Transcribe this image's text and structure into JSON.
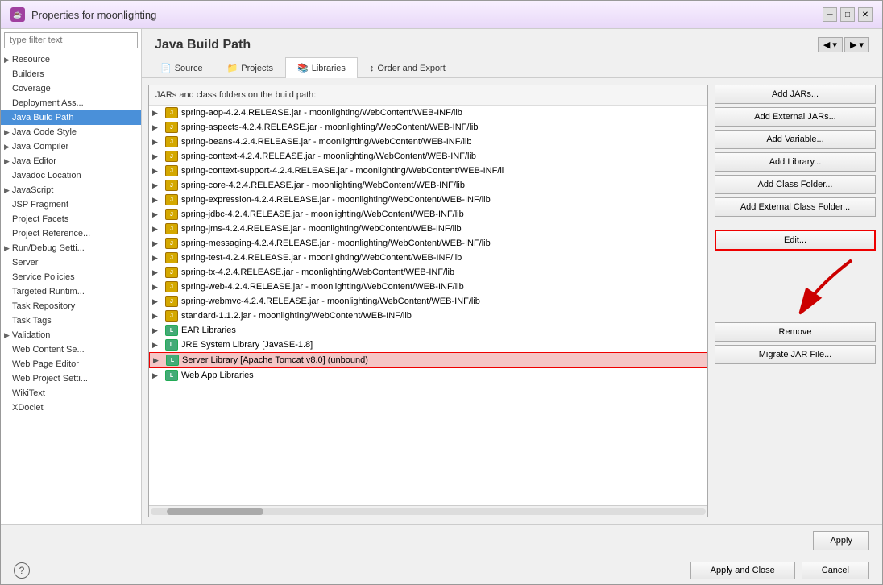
{
  "window": {
    "title": "Properties for moonlighting",
    "title_icon": "☕"
  },
  "sidebar": {
    "search_placeholder": "type filter text",
    "items": [
      {
        "label": "Resource",
        "arrow": true,
        "active": false
      },
      {
        "label": "Builders",
        "arrow": false,
        "active": false
      },
      {
        "label": "Coverage",
        "arrow": false,
        "active": false
      },
      {
        "label": "Deployment Ass...",
        "arrow": false,
        "active": false
      },
      {
        "label": "Java Build Path",
        "arrow": false,
        "active": true
      },
      {
        "label": "Java Code Style",
        "arrow": true,
        "active": false
      },
      {
        "label": "Java Compiler",
        "arrow": true,
        "active": false
      },
      {
        "label": "Java Editor",
        "arrow": true,
        "active": false
      },
      {
        "label": "Javadoc Location",
        "arrow": false,
        "active": false
      },
      {
        "label": "JavaScript",
        "arrow": true,
        "active": false
      },
      {
        "label": "JSP Fragment",
        "arrow": false,
        "active": false
      },
      {
        "label": "Project Facets",
        "arrow": false,
        "active": false
      },
      {
        "label": "Project Reference...",
        "arrow": false,
        "active": false
      },
      {
        "label": "Run/Debug Setti...",
        "arrow": true,
        "active": false
      },
      {
        "label": "Server",
        "arrow": false,
        "active": false
      },
      {
        "label": "Service Policies",
        "arrow": false,
        "active": false
      },
      {
        "label": "Targeted Runtim...",
        "arrow": false,
        "active": false
      },
      {
        "label": "Task Repository",
        "arrow": false,
        "active": false
      },
      {
        "label": "Task Tags",
        "arrow": false,
        "active": false
      },
      {
        "label": "Validation",
        "arrow": true,
        "active": false
      },
      {
        "label": "Web Content Se...",
        "arrow": false,
        "active": false
      },
      {
        "label": "Web Page Editor",
        "arrow": false,
        "active": false
      },
      {
        "label": "Web Project Setti...",
        "arrow": false,
        "active": false
      },
      {
        "label": "WikiText",
        "arrow": false,
        "active": false
      },
      {
        "label": "XDoclet",
        "arrow": false,
        "active": false
      }
    ]
  },
  "main": {
    "title": "Java Build Path",
    "tabs": [
      {
        "label": "Source",
        "icon": "📄"
      },
      {
        "label": "Projects",
        "icon": "📁"
      },
      {
        "label": "Libraries",
        "icon": "📚",
        "active": true
      },
      {
        "label": "Order and Export",
        "icon": "↕"
      }
    ],
    "tree_header": "JARs and class folders on the build path:",
    "tree_items": [
      {
        "type": "jar",
        "text": "spring-aop-4.2.4.RELEASE.jar - moonlighting/WebContent/WEB-INF/lib"
      },
      {
        "type": "jar",
        "text": "spring-aspects-4.2.4.RELEASE.jar - moonlighting/WebContent/WEB-INF/lib"
      },
      {
        "type": "jar",
        "text": "spring-beans-4.2.4.RELEASE.jar - moonlighting/WebContent/WEB-INF/lib"
      },
      {
        "type": "jar",
        "text": "spring-context-4.2.4.RELEASE.jar - moonlighting/WebContent/WEB-INF/lib"
      },
      {
        "type": "jar",
        "text": "spring-context-support-4.2.4.RELEASE.jar - moonlighting/WebContent/WEB-INF/li"
      },
      {
        "type": "jar",
        "text": "spring-core-4.2.4.RELEASE.jar - moonlighting/WebContent/WEB-INF/lib"
      },
      {
        "type": "jar",
        "text": "spring-expression-4.2.4.RELEASE.jar - moonlighting/WebContent/WEB-INF/lib"
      },
      {
        "type": "jar",
        "text": "spring-jdbc-4.2.4.RELEASE.jar - moonlighting/WebContent/WEB-INF/lib"
      },
      {
        "type": "jar",
        "text": "spring-jms-4.2.4.RELEASE.jar - moonlighting/WebContent/WEB-INF/lib"
      },
      {
        "type": "jar",
        "text": "spring-messaging-4.2.4.RELEASE.jar - moonlighting/WebContent/WEB-INF/lib"
      },
      {
        "type": "jar",
        "text": "spring-test-4.2.4.RELEASE.jar - moonlighting/WebContent/WEB-INF/lib"
      },
      {
        "type": "jar",
        "text": "spring-tx-4.2.4.RELEASE.jar - moonlighting/WebContent/WEB-INF/lib"
      },
      {
        "type": "jar",
        "text": "spring-web-4.2.4.RELEASE.jar - moonlighting/WebContent/WEB-INF/lib"
      },
      {
        "type": "jar",
        "text": "spring-webmvc-4.2.4.RELEASE.jar - moonlighting/WebContent/WEB-INF/lib"
      },
      {
        "type": "jar",
        "text": "standard-1.1.2.jar - moonlighting/WebContent/WEB-INF/lib"
      },
      {
        "type": "lib",
        "text": "EAR Libraries"
      },
      {
        "type": "lib",
        "text": "JRE System Library [JavaSE-1.8]"
      },
      {
        "type": "lib",
        "text": "Server Library [Apache Tomcat v8.0] (unbound)",
        "selected": true
      },
      {
        "type": "lib",
        "text": "Web App Libraries"
      }
    ],
    "buttons": [
      {
        "label": "Add JARs...",
        "name": "add-jars-button"
      },
      {
        "label": "Add External JARs...",
        "name": "add-external-jars-button"
      },
      {
        "label": "Add Variable...",
        "name": "add-variable-button"
      },
      {
        "label": "Add Library...",
        "name": "add-library-button"
      },
      {
        "label": "Add Class Folder...",
        "name": "add-class-folder-button"
      },
      {
        "label": "Add External Class Folder...",
        "name": "add-external-class-folder-button"
      },
      {
        "label": "Edit...",
        "name": "edit-button",
        "highlighted": true
      },
      {
        "label": "Remove",
        "name": "remove-button"
      },
      {
        "label": "Migrate JAR File...",
        "name": "migrate-jar-button"
      }
    ]
  },
  "footer": {
    "apply_label": "Apply",
    "apply_close_label": "Apply and Close",
    "cancel_label": "Cancel"
  }
}
